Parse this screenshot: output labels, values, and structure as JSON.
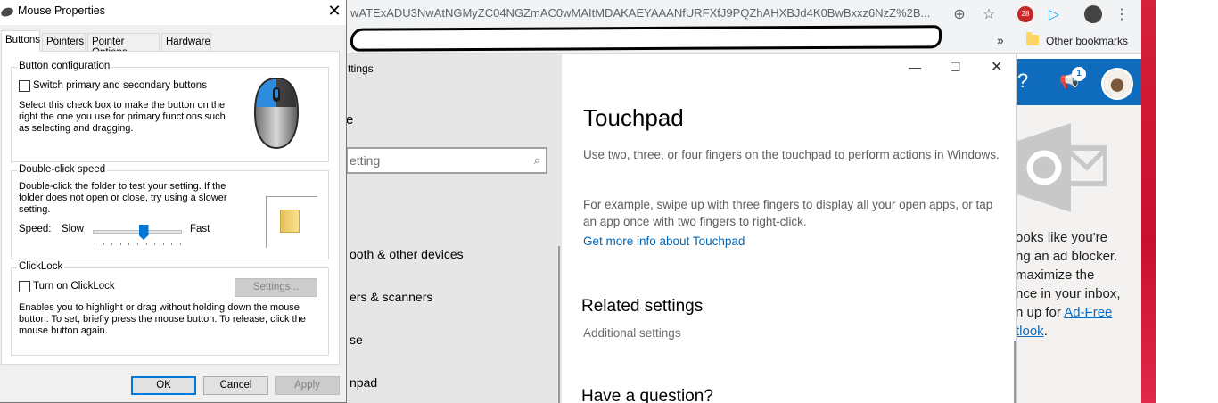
{
  "browser": {
    "url": "wATExADU3NwAtNGMyZC04NGZmAC0wMAItMDAKAEYAAANfURFXfJ9PQZhAHXBJd4K0BwBxxz6NzZ%2B...",
    "other_bookmarks": "Other bookmarks",
    "badge_count": "28"
  },
  "settings_app": {
    "left_title": "ttings",
    "home": "e",
    "search_placeholder": "etting",
    "nav": [
      "ooth & other devices",
      "ers & scanners",
      "se",
      "npad"
    ],
    "page_title": "Touchpad",
    "desc1": "Use two, three, or four fingers on the touchpad to perform actions in Windows.",
    "desc2": "For example, swipe up with three fingers to display all your open apps, or tap an app once with two fingers to right-click.",
    "link": "Get more info about Touchpad",
    "related_title": "Related settings",
    "additional": "Additional settings",
    "question_title": "Have a question?"
  },
  "outlook": {
    "help": "?",
    "badge": "1",
    "adblock_lines": [
      "ooks like you're",
      "ng an ad blocker.",
      "maximize the",
      "nce in your inbox,",
      "n up for "
    ],
    "adblock_link1": "Ad-Free",
    "adblock_link2": "tlook",
    "adblock_end": "."
  },
  "dialog": {
    "title": "Mouse Properties",
    "tabs": [
      "Buttons",
      "Pointers",
      "Pointer Options",
      "Hardware"
    ],
    "button_config": {
      "title": "Button configuration",
      "switch_label": "Switch primary and secondary buttons",
      "description": "Select this check box to make the button on the right the one you use for primary functions such as selecting and dragging."
    },
    "double_click": {
      "title": "Double-click speed",
      "description": "Double-click the folder to test your setting. If the folder does not open or close, try using a slower setting.",
      "speed_label": "Speed:",
      "slow": "Slow",
      "fast": "Fast",
      "speed_value_fraction": 0.57
    },
    "clicklock": {
      "title": "ClickLock",
      "turn_on": "Turn on ClickLock",
      "settings_button": "Settings...",
      "description": "Enables you to highlight or drag without holding down the mouse button. To set, briefly press the mouse button. To release, click the mouse button again."
    },
    "buttons": {
      "ok": "OK",
      "cancel": "Cancel",
      "apply": "Apply"
    }
  }
}
